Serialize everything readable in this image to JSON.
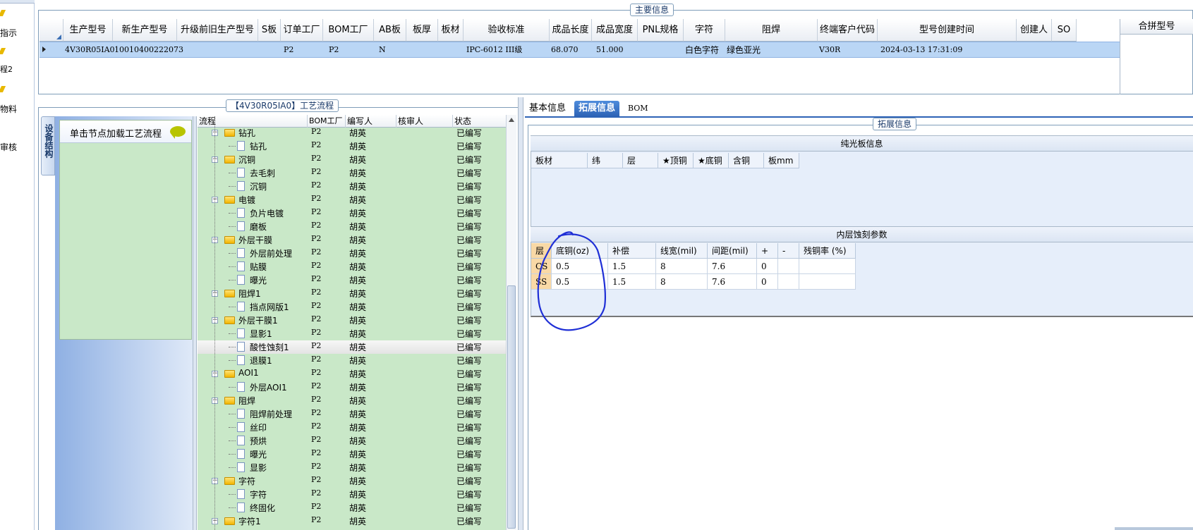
{
  "left_nav": {
    "items": [
      "指示",
      "程2",
      "物料",
      "审核"
    ]
  },
  "main_info": {
    "title": "主要信息",
    "columns": [
      "生产型号",
      "新生产型号",
      "升级前旧生产型号",
      "S板",
      "订单工厂",
      "BOM工厂",
      "AB板",
      "板厚",
      "板材",
      "验收标准",
      "成品长度",
      "成品宽度",
      "PNL规格",
      "字符",
      "阻焊",
      "终端客户代码",
      "型号创建时间",
      "创建人",
      "SO"
    ],
    "row": {
      "prod_model": "4V30R05IA0",
      "new_prod_model": "10010400222073",
      "order_factory": "P2",
      "bom_factory": "P2",
      "ab_board": "N",
      "standard": "IPC-6012 III级",
      "length": "68.070",
      "width": "51.000",
      "char": "白色字符",
      "solder_mask": "绿色亚光",
      "customer_code": "V30R",
      "created_time": "2024-03-13 17:31:09"
    },
    "merge_header": "合拼型号"
  },
  "process": {
    "title": "【4V30R05IA0】工艺流程",
    "side_tab": "设备结构",
    "hint": "单击节点加载工艺流程",
    "columns": [
      "流程",
      "BOM工厂",
      "编写人",
      "核审人",
      "状态"
    ],
    "rows": [
      {
        "name": "钻孔",
        "level": 1,
        "bom": "P2",
        "writer": "胡英",
        "status": "已编写"
      },
      {
        "name": "钻孔",
        "level": 2,
        "bom": "P2",
        "writer": "胡英",
        "status": "已编写"
      },
      {
        "name": "沉铜",
        "level": 1,
        "bom": "P2",
        "writer": "胡英",
        "status": "已编写"
      },
      {
        "name": "去毛刺",
        "level": 2,
        "bom": "P2",
        "writer": "胡英",
        "status": "已编写"
      },
      {
        "name": "沉铜",
        "level": 2,
        "bom": "P2",
        "writer": "胡英",
        "status": "已编写"
      },
      {
        "name": "电镀",
        "level": 1,
        "bom": "P2",
        "writer": "胡英",
        "status": "已编写"
      },
      {
        "name": "负片电镀",
        "level": 2,
        "bom": "P2",
        "writer": "胡英",
        "status": "已编写"
      },
      {
        "name": "磨板",
        "level": 2,
        "bom": "P2",
        "writer": "胡英",
        "status": "已编写"
      },
      {
        "name": "外层干膜",
        "level": 1,
        "bom": "P2",
        "writer": "胡英",
        "status": "已编写"
      },
      {
        "name": "外层前处理",
        "level": 2,
        "bom": "P2",
        "writer": "胡英",
        "status": "已编写"
      },
      {
        "name": "贴膜",
        "level": 2,
        "bom": "P2",
        "writer": "胡英",
        "status": "已编写"
      },
      {
        "name": "曝光",
        "level": 2,
        "bom": "P2",
        "writer": "胡英",
        "status": "已编写"
      },
      {
        "name": "阻焊1",
        "level": 1,
        "bom": "P2",
        "writer": "胡英",
        "status": "已编写"
      },
      {
        "name": "挡点网版1",
        "level": 2,
        "bom": "P2",
        "writer": "胡英",
        "status": "已编写"
      },
      {
        "name": "外层干膜1",
        "level": 1,
        "bom": "P2",
        "writer": "胡英",
        "status": "已编写"
      },
      {
        "name": "显影1",
        "level": 2,
        "bom": "P2",
        "writer": "胡英",
        "status": "已编写"
      },
      {
        "name": "酸性蚀刻1",
        "level": 2,
        "bom": "P2",
        "writer": "胡英",
        "status": "已编写",
        "selected": true
      },
      {
        "name": "退膜1",
        "level": 2,
        "bom": "P2",
        "writer": "胡英",
        "status": "已编写"
      },
      {
        "name": "AOI1",
        "level": 1,
        "bom": "P2",
        "writer": "胡英",
        "status": "已编写"
      },
      {
        "name": "外层AOI1",
        "level": 2,
        "bom": "P2",
        "writer": "胡英",
        "status": "已编写"
      },
      {
        "name": "阻焊",
        "level": 1,
        "bom": "P2",
        "writer": "胡英",
        "status": "已编写"
      },
      {
        "name": "阻焊前处理",
        "level": 2,
        "bom": "P2",
        "writer": "胡英",
        "status": "已编写"
      },
      {
        "name": "丝印",
        "level": 2,
        "bom": "P2",
        "writer": "胡英",
        "status": "已编写"
      },
      {
        "name": "预烘",
        "level": 2,
        "bom": "P2",
        "writer": "胡英",
        "status": "已编写"
      },
      {
        "name": "曝光",
        "level": 2,
        "bom": "P2",
        "writer": "胡英",
        "status": "已编写"
      },
      {
        "name": "显影",
        "level": 2,
        "bom": "P2",
        "writer": "胡英",
        "status": "已编写"
      },
      {
        "name": "字符",
        "level": 1,
        "bom": "P2",
        "writer": "胡英",
        "status": "已编写"
      },
      {
        "name": "字符",
        "level": 2,
        "bom": "P2",
        "writer": "胡英",
        "status": "已编写"
      },
      {
        "name": "终固化",
        "level": 2,
        "bom": "P2",
        "writer": "胡英",
        "status": "已编写"
      },
      {
        "name": "字符1",
        "level": 1,
        "bom": "P2",
        "writer": "胡英",
        "status": "已编写"
      }
    ]
  },
  "details": {
    "tabs": [
      "基本信息",
      "拓展信息",
      "BOM"
    ],
    "active_tab": "拓展信息",
    "group_title": "拓展信息",
    "bare_board": {
      "title": "纯光板信息",
      "columns": [
        "板材",
        "纬",
        "层",
        "★顶铜",
        "★底铜",
        "含铜",
        "板mm"
      ]
    },
    "etching": {
      "title": "内层蚀刻参数",
      "columns": [
        "层",
        "底铜(oz)",
        "补偿",
        "线宽(mil)",
        "间距(mil)",
        "+",
        "-",
        "残铜率 (%)"
      ],
      "rows": [
        [
          "CS",
          "0.5",
          "1.5",
          "8",
          "7.6",
          "0",
          "",
          ""
        ],
        [
          "SS",
          "0.5",
          "1.5",
          "8",
          "7.6",
          "0",
          "",
          ""
        ]
      ]
    }
  },
  "colors": {
    "tree_bg": "#c9e8c8",
    "selected_row": "#bad6f5",
    "active_tab": "#2d63b6",
    "annotation": "#1f2fd6"
  }
}
